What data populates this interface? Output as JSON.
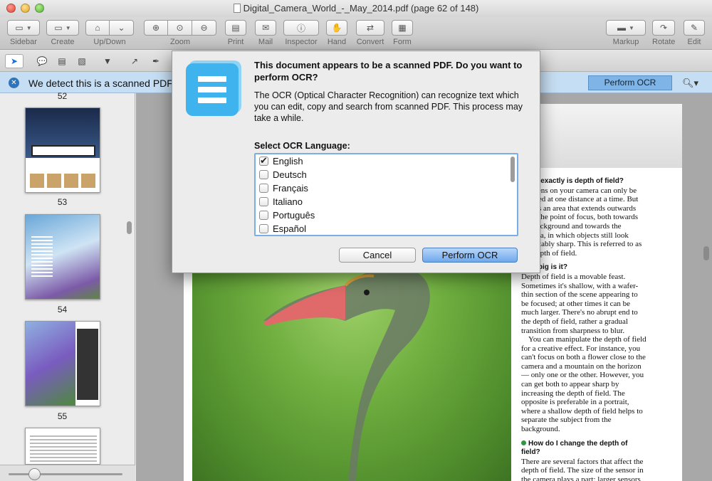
{
  "window": {
    "title": "Digital_Camera_World_-_May_2014.pdf (page 62 of 148)"
  },
  "toolbar": {
    "sidebar": "Sidebar",
    "create": "Create",
    "updown": "Up/Down",
    "zoom": "Zoom",
    "print": "Print",
    "mail": "Mail",
    "inspector": "Inspector",
    "hand": "Hand",
    "convert": "Convert",
    "form": "Form",
    "markup": "Markup",
    "rotate": "Rotate",
    "edit": "Edit"
  },
  "ocr_bar": {
    "message": "We detect this is a scanned PDF",
    "button": "Perform OCR"
  },
  "sidebar": {
    "pages": [
      "52",
      "53",
      "54",
      "55"
    ]
  },
  "dialog": {
    "title": "This document appears to be a scanned PDF. Do you want to perform OCR?",
    "body": "The OCR (Optical Character Recognition) can recognize text which you can edit, copy and search from scanned PDF. This process may take a while.",
    "language_label": "Select OCR Language:",
    "languages": [
      {
        "name": "English",
        "checked": true
      },
      {
        "name": "Deutsch",
        "checked": false
      },
      {
        "name": "Français",
        "checked": false
      },
      {
        "name": "Italiano",
        "checked": false
      },
      {
        "name": "Português",
        "checked": false
      },
      {
        "name": "Español",
        "checked": false
      }
    ],
    "cancel": "Cancel",
    "ok": "Perform OCR"
  },
  "article": {
    "h1": "What exactly is depth of field?",
    "p1": "The lens on your camera can only be focused at one distance at a time. But there's an area that extends outwards from the point of focus, both towards the background and towards the camera, in which objects still look acceptably sharp. This is referred to as the depth of field.",
    "h2": "How big is it?",
    "p2": "Depth of field is a movable feast. Sometimes it's shallow, with a wafer-thin section of the scene appearing to be focused; at other times it can be much larger. There's no abrupt end to the depth of field, rather a gradual transition from sharpness to blur.",
    "p3": "You can manipulate the depth of field for a creative effect. For instance, you can't focus on both a flower close to the camera and a mountain on the horizon — only one or the other. However, you can get both to appear sharp by increasing the depth of field. The opposite is preferable in a portrait, where a shallow depth of field helps to separate the subject from the background.",
    "h3": "How do I change the depth of field?",
    "p4": "There are several factors that affect the depth of field. The size of the sensor in the camera plays a part: larger sensors make it easier to"
  }
}
